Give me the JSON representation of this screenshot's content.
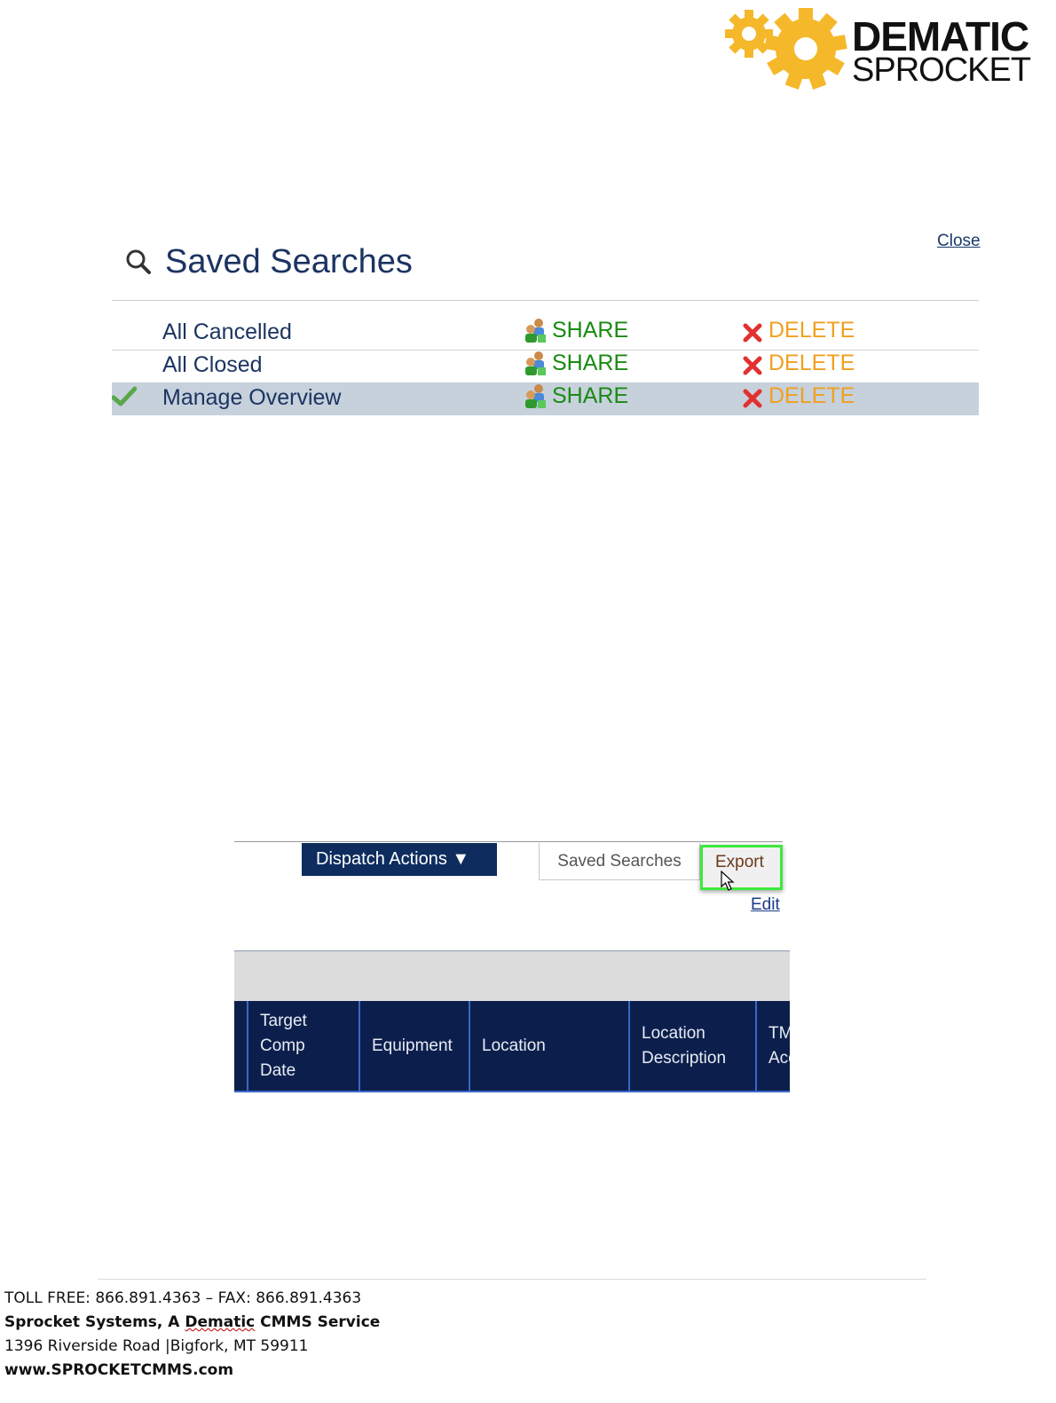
{
  "logo": {
    "line1": "DEMATIC",
    "line2": "SPROCKET",
    "gear_color": "#f5b82a"
  },
  "saved_searches": {
    "title": "Saved Searches",
    "close_label": "Close",
    "rows": [
      {
        "name": "All Cancelled",
        "share": "SHARE",
        "delete": "DELETE",
        "selected": false
      },
      {
        "name": "All Closed",
        "share": "SHARE",
        "delete": "DELETE",
        "selected": false
      },
      {
        "name": "Manage Overview",
        "share": "SHARE",
        "delete": "DELETE",
        "selected": true
      }
    ]
  },
  "toolbar": {
    "dispatch_label": "Dispatch Actions ▼",
    "saved_searches_label": "Saved Searches",
    "export_label": "Export",
    "edit_label": "Edit"
  },
  "grid": {
    "columns": [
      {
        "label": "Target\nComp\nDate"
      },
      {
        "label": "Equipment"
      },
      {
        "label": "Location"
      },
      {
        "label": "Location\nDescription"
      },
      {
        "label": "TM\nAcc"
      }
    ]
  },
  "footer": {
    "phone": "TOLL FREE: 866.891.4363 – FAX: 866.891.4363",
    "company_part1": "Sprocket Systems, A ",
    "company_part2": "Dematic",
    "company_part3": " CMMS Service",
    "address": "1396 Riverside  Road |Bigfork, MT 59911",
    "website": "www.SPROCKETCMMS.com"
  },
  "colors": {
    "navy": "#0e2d5e",
    "share_green": "#1a8a12",
    "delete_orange": "#f0a020",
    "selected_row": "#c6d1dc",
    "export_highlight": "#3ee83e"
  }
}
